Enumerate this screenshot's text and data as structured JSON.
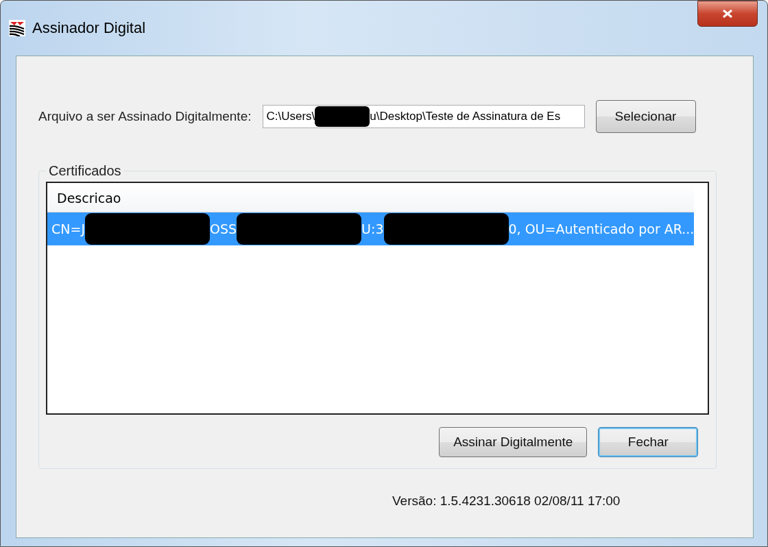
{
  "window": {
    "title": "Assinador Digital"
  },
  "file_field": {
    "label": "Arquivo a ser Assinado Digitalmente:",
    "value_parts": [
      {
        "kind": "text",
        "text": "C:\\Users\\"
      },
      {
        "kind": "redaction"
      },
      {
        "kind": "text",
        "text": "u\\Desktop\\Teste de Assinatura de Es"
      }
    ]
  },
  "select_button": "Selecionar",
  "certificates": {
    "title": "Certificados",
    "columns": [
      "Descricao"
    ],
    "rows": [
      {
        "selected": true,
        "parts": [
          {
            "kind": "text",
            "text": "CN=J"
          },
          {
            "kind": "redaction"
          },
          {
            "kind": "text",
            "text": "OSS"
          },
          {
            "kind": "redaction"
          },
          {
            "kind": "text",
            "text": "U:3"
          },
          {
            "kind": "redaction"
          },
          {
            "kind": "text",
            "text": "0, OU=Autenticado por AR..."
          }
        ]
      }
    ]
  },
  "buttons": [
    {
      "label": "Assinar Digitalmente",
      "selected": false
    },
    {
      "label": "Fechar",
      "selected": true
    }
  ],
  "version": "Versão: 1.5.4231.30618 02/08/11 17:00"
}
